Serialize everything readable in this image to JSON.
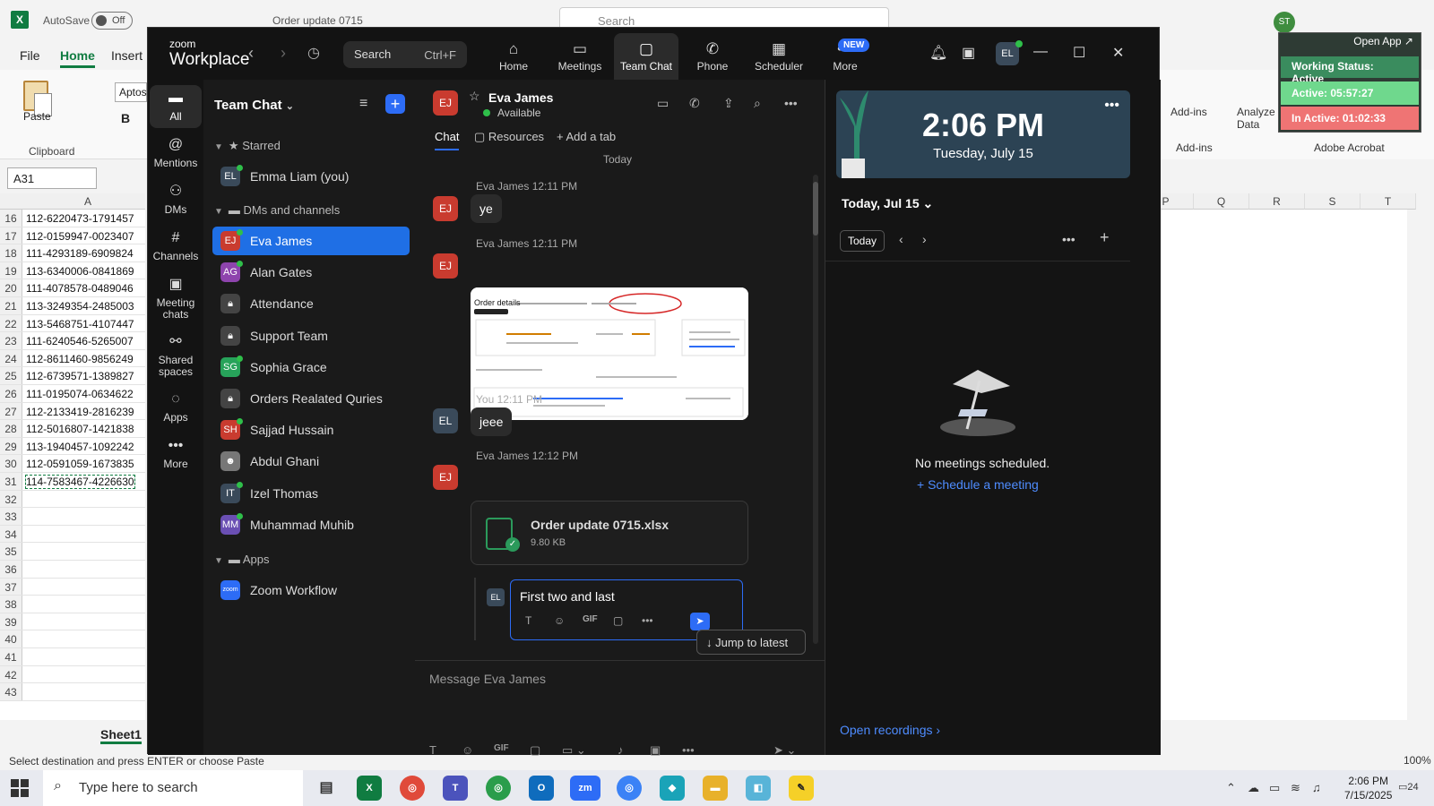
{
  "excel": {
    "autosave_label": "AutoSave",
    "autosave_state": "Off",
    "doc_name": "Order update 0715",
    "search_placeholder": "Search",
    "user_initials": "ST",
    "menu": [
      "File",
      "Home",
      "Insert"
    ],
    "paste_label": "Paste",
    "clipboard_label": "Clipboard",
    "font_name": "Aptos",
    "bold_label": "B",
    "namebox": "A31",
    "column_a": "A",
    "rows": [
      {
        "n": "16",
        "v": "112-6220473-1791457"
      },
      {
        "n": "17",
        "v": "112-0159947-0023407"
      },
      {
        "n": "18",
        "v": "111-4293189-6909824"
      },
      {
        "n": "19",
        "v": "113-6340006-0841869"
      },
      {
        "n": "20",
        "v": "111-4078578-0489046"
      },
      {
        "n": "21",
        "v": "113-3249354-2485003"
      },
      {
        "n": "22",
        "v": "113-5468751-4107447"
      },
      {
        "n": "23",
        "v": "111-6240546-5265007"
      },
      {
        "n": "24",
        "v": "112-8611460-9856249"
      },
      {
        "n": "25",
        "v": "112-6739571-1389827"
      },
      {
        "n": "26",
        "v": "111-0195074-0634622"
      },
      {
        "n": "27",
        "v": "112-2133419-2816239"
      },
      {
        "n": "28",
        "v": "112-5016807-1421838"
      },
      {
        "n": "29",
        "v": "113-1940457-1092242"
      },
      {
        "n": "30",
        "v": "112-0591059-1673835"
      },
      {
        "n": "31",
        "v": "114-7583467-4226630"
      },
      {
        "n": "32",
        "v": ""
      },
      {
        "n": "33",
        "v": ""
      },
      {
        "n": "34",
        "v": ""
      },
      {
        "n": "35",
        "v": ""
      },
      {
        "n": "36",
        "v": ""
      },
      {
        "n": "37",
        "v": ""
      },
      {
        "n": "38",
        "v": ""
      },
      {
        "n": "39",
        "v": ""
      },
      {
        "n": "40",
        "v": ""
      },
      {
        "n": "41",
        "v": ""
      },
      {
        "n": "42",
        "v": ""
      },
      {
        "n": "43",
        "v": ""
      }
    ],
    "right_cols": [
      "P",
      "Q",
      "R",
      "S",
      "T"
    ],
    "addins_label": "Add-ins",
    "addins_group": "Add-ins",
    "analyze_label": "Analyze Data",
    "acrobat_label": "Adobe Acrobat",
    "sheet_tab": "Sheet1",
    "status_text": "Select destination and press ENTER or choose Paste",
    "zoom_level": "100%"
  },
  "widget": {
    "open_app": "Open App ↗",
    "working_status": "Working Status: Active",
    "active": "Active: 05:57:27",
    "inactive": "In Active: 01:02:33"
  },
  "zoom": {
    "brand_small": "zoom",
    "brand_big": "Workplace",
    "search_label": "Search",
    "search_shortcut": "Ctrl+F",
    "tabs": [
      {
        "label": "Home",
        "icon": "⌂"
      },
      {
        "label": "Meetings",
        "icon": "▭"
      },
      {
        "label": "Team Chat",
        "icon": "▢"
      },
      {
        "label": "Phone",
        "icon": "✆"
      },
      {
        "label": "Scheduler",
        "icon": "▦"
      },
      {
        "label": "More",
        "icon": "•••"
      }
    ],
    "new_badge": "NEW",
    "avatar_initials": "EL",
    "rail": [
      {
        "label": "All",
        "icon": "▬"
      },
      {
        "label": "Mentions",
        "icon": "@"
      },
      {
        "label": "DMs",
        "icon": "⚇"
      },
      {
        "label": "Channels",
        "icon": "#"
      },
      {
        "label": "Meeting chats",
        "icon": "▣"
      },
      {
        "label": "Shared spaces",
        "icon": "⚯"
      },
      {
        "label": "Apps",
        "icon": "◌"
      },
      {
        "label": "More",
        "icon": "•••"
      }
    ],
    "list": {
      "title": "Team Chat",
      "starred_label": "Starred",
      "dms_label": "DMs and channels",
      "apps_label": "Apps",
      "starred": [
        {
          "initials": "EL",
          "name": "Emma Liam (you)",
          "color": "#3a4a5a"
        }
      ],
      "items": [
        {
          "initials": "EJ",
          "name": "Eva James",
          "color": "#c93b2f"
        },
        {
          "initials": "AG",
          "name": "Alan Gates",
          "color": "#8e44ad"
        },
        {
          "initials": "",
          "name": "Attendance",
          "color": "#444444"
        },
        {
          "initials": "",
          "name": "Support Team",
          "color": "#444444"
        },
        {
          "initials": "SG",
          "name": "Sophia Grace",
          "color": "#27a35a"
        },
        {
          "initials": "",
          "name": "Orders Realated Quries",
          "color": "#444444"
        },
        {
          "initials": "SH",
          "name": "Sajjad Hussain",
          "color": "#c93b2f"
        },
        {
          "initials": "",
          "name": "Abdul Ghani",
          "color": "#777777"
        },
        {
          "initials": "IT",
          "name": "Izel Thomas",
          "color": "#3a4a5a"
        },
        {
          "initials": "MM",
          "name": "Muhammad Muhib",
          "color": "#6a4fb3"
        }
      ],
      "apps": [
        {
          "initials": "zoom",
          "name": "Zoom Workflow",
          "color": "#2d6cf6"
        }
      ]
    },
    "chat": {
      "contact_initials": "EJ",
      "contact_name": "Eva James",
      "contact_status": "Available",
      "tab_chat": "Chat",
      "tab_resources": "Resources",
      "tab_add": "Add a tab",
      "today": "Today",
      "messages": [
        {
          "initials": "EJ",
          "meta": "Eva James 12:11 PM",
          "text": "ye"
        },
        {
          "initials": "EJ",
          "meta": "Eva James 12:11 PM",
          "text": ""
        },
        {
          "initials": "EL",
          "meta": "You 12:11 PM",
          "text": "jeee"
        },
        {
          "initials": "EJ",
          "meta": "Eva James 12:12 PM",
          "text": ""
        }
      ],
      "image_title": "Order details",
      "file_name": "Order update 0715.xlsx",
      "file_size": "9.80 KB",
      "reply_initials": "EL",
      "reply_text": "First two and last",
      "reply_gif": "GIF",
      "jump_label": "Jump to latest",
      "compose_placeholder": "Message Eva James",
      "compose_gif": "GIF"
    },
    "calendar": {
      "time": "2:06 PM",
      "date": "Tuesday, July 15",
      "heading": "Today, Jul 15",
      "today_button": "Today",
      "empty": "No meetings scheduled.",
      "schedule": "Schedule a meeting",
      "recordings": "Open recordings"
    }
  },
  "taskbar": {
    "search_placeholder": "Type here to search",
    "time": "2:06 PM",
    "date": "7/15/2025",
    "notification_count": "24"
  }
}
